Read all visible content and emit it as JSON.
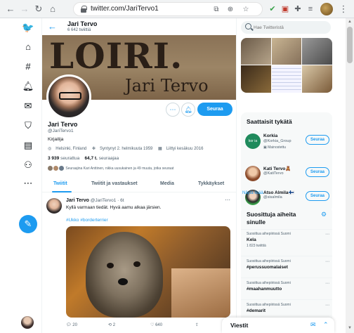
{
  "browser": {
    "url": "twitter.com/JariTervo1"
  },
  "header": {
    "name": "Jari Tervo",
    "tweet_count": "6 642 twiittiä"
  },
  "banner": {
    "title": "LOIRI.",
    "subtitle": "Jari Tervo"
  },
  "profile": {
    "follow_label": "Seuraa",
    "name": "Jari Tervo",
    "handle": "@JariTervo1",
    "bio": "Kirjailija",
    "location": "Helsinki, Finland",
    "birth": "Syntynyt 2. helmikuuta 1959",
    "joined": "Liittyi kesäkuu 2016",
    "following_num": "3 939",
    "following_label": "seurattua",
    "followers_num": "64,7 t.",
    "followers_label": "seuraajaa",
    "followed_by": "Seuraajina Kari Anttinen, nikka uusukainen ja 49 muuta, jotka seuraat"
  },
  "tabs": [
    "Twiitit",
    "Twiitit ja vastaukset",
    "Media",
    "Tykkäykset"
  ],
  "tweet": {
    "name": "Jari Tervo",
    "handle": "@JariTervo1 · 6t",
    "text": "Kyllä varmaan tiedät. Hyvä aamu alkaa järsien.",
    "tags": "#Ukko #borderterrier",
    "replies": "20",
    "retweets": "2",
    "likes": "640"
  },
  "search": {
    "placeholder": "Hae Twitteristä"
  },
  "suggestions": {
    "title": "Saattaisit tykätä",
    "items": [
      {
        "name": "Korkia",
        "handle": "@Korkia_Group",
        "ad": "Mainostettu",
        "button": "Seuraa",
        "avatar_text": "kor ia",
        "color": "#1f8a5c"
      },
      {
        "name": "Kati Tervo🧸",
        "handle": "@KatiTervo",
        "ad": "",
        "button": "Seuraa",
        "avatar_text": "",
        "color": "#9a5a3a"
      },
      {
        "name": "Atso Almila🇫🇮",
        "handle": "@sisalmila",
        "ad": "",
        "button": "Seuraa",
        "avatar_text": "",
        "color": "#3aa34a"
      }
    ],
    "more": "Näytä lisää"
  },
  "trends": {
    "title": "Suosittuja aiheita sinulle",
    "items": [
      {
        "context": "Suosittua aihepiirissä Suomi",
        "name": "Kela",
        "count": "1 823 twiittiä"
      },
      {
        "context": "Suosittua aihepiirissä Suomi",
        "name": "#perussuomalaiset",
        "count": ""
      },
      {
        "context": "Suosittua aihepiirissä Suomi",
        "name": "#maahanmuutto",
        "count": ""
      },
      {
        "context": "Suosittua aihepiirissä Suomi",
        "name": "#demarit",
        "count": ""
      }
    ]
  },
  "messages": {
    "title": "Viestit"
  },
  "colors": {
    "accent": "#1d9bf0",
    "text": "#0f1419",
    "muted": "#536471"
  }
}
